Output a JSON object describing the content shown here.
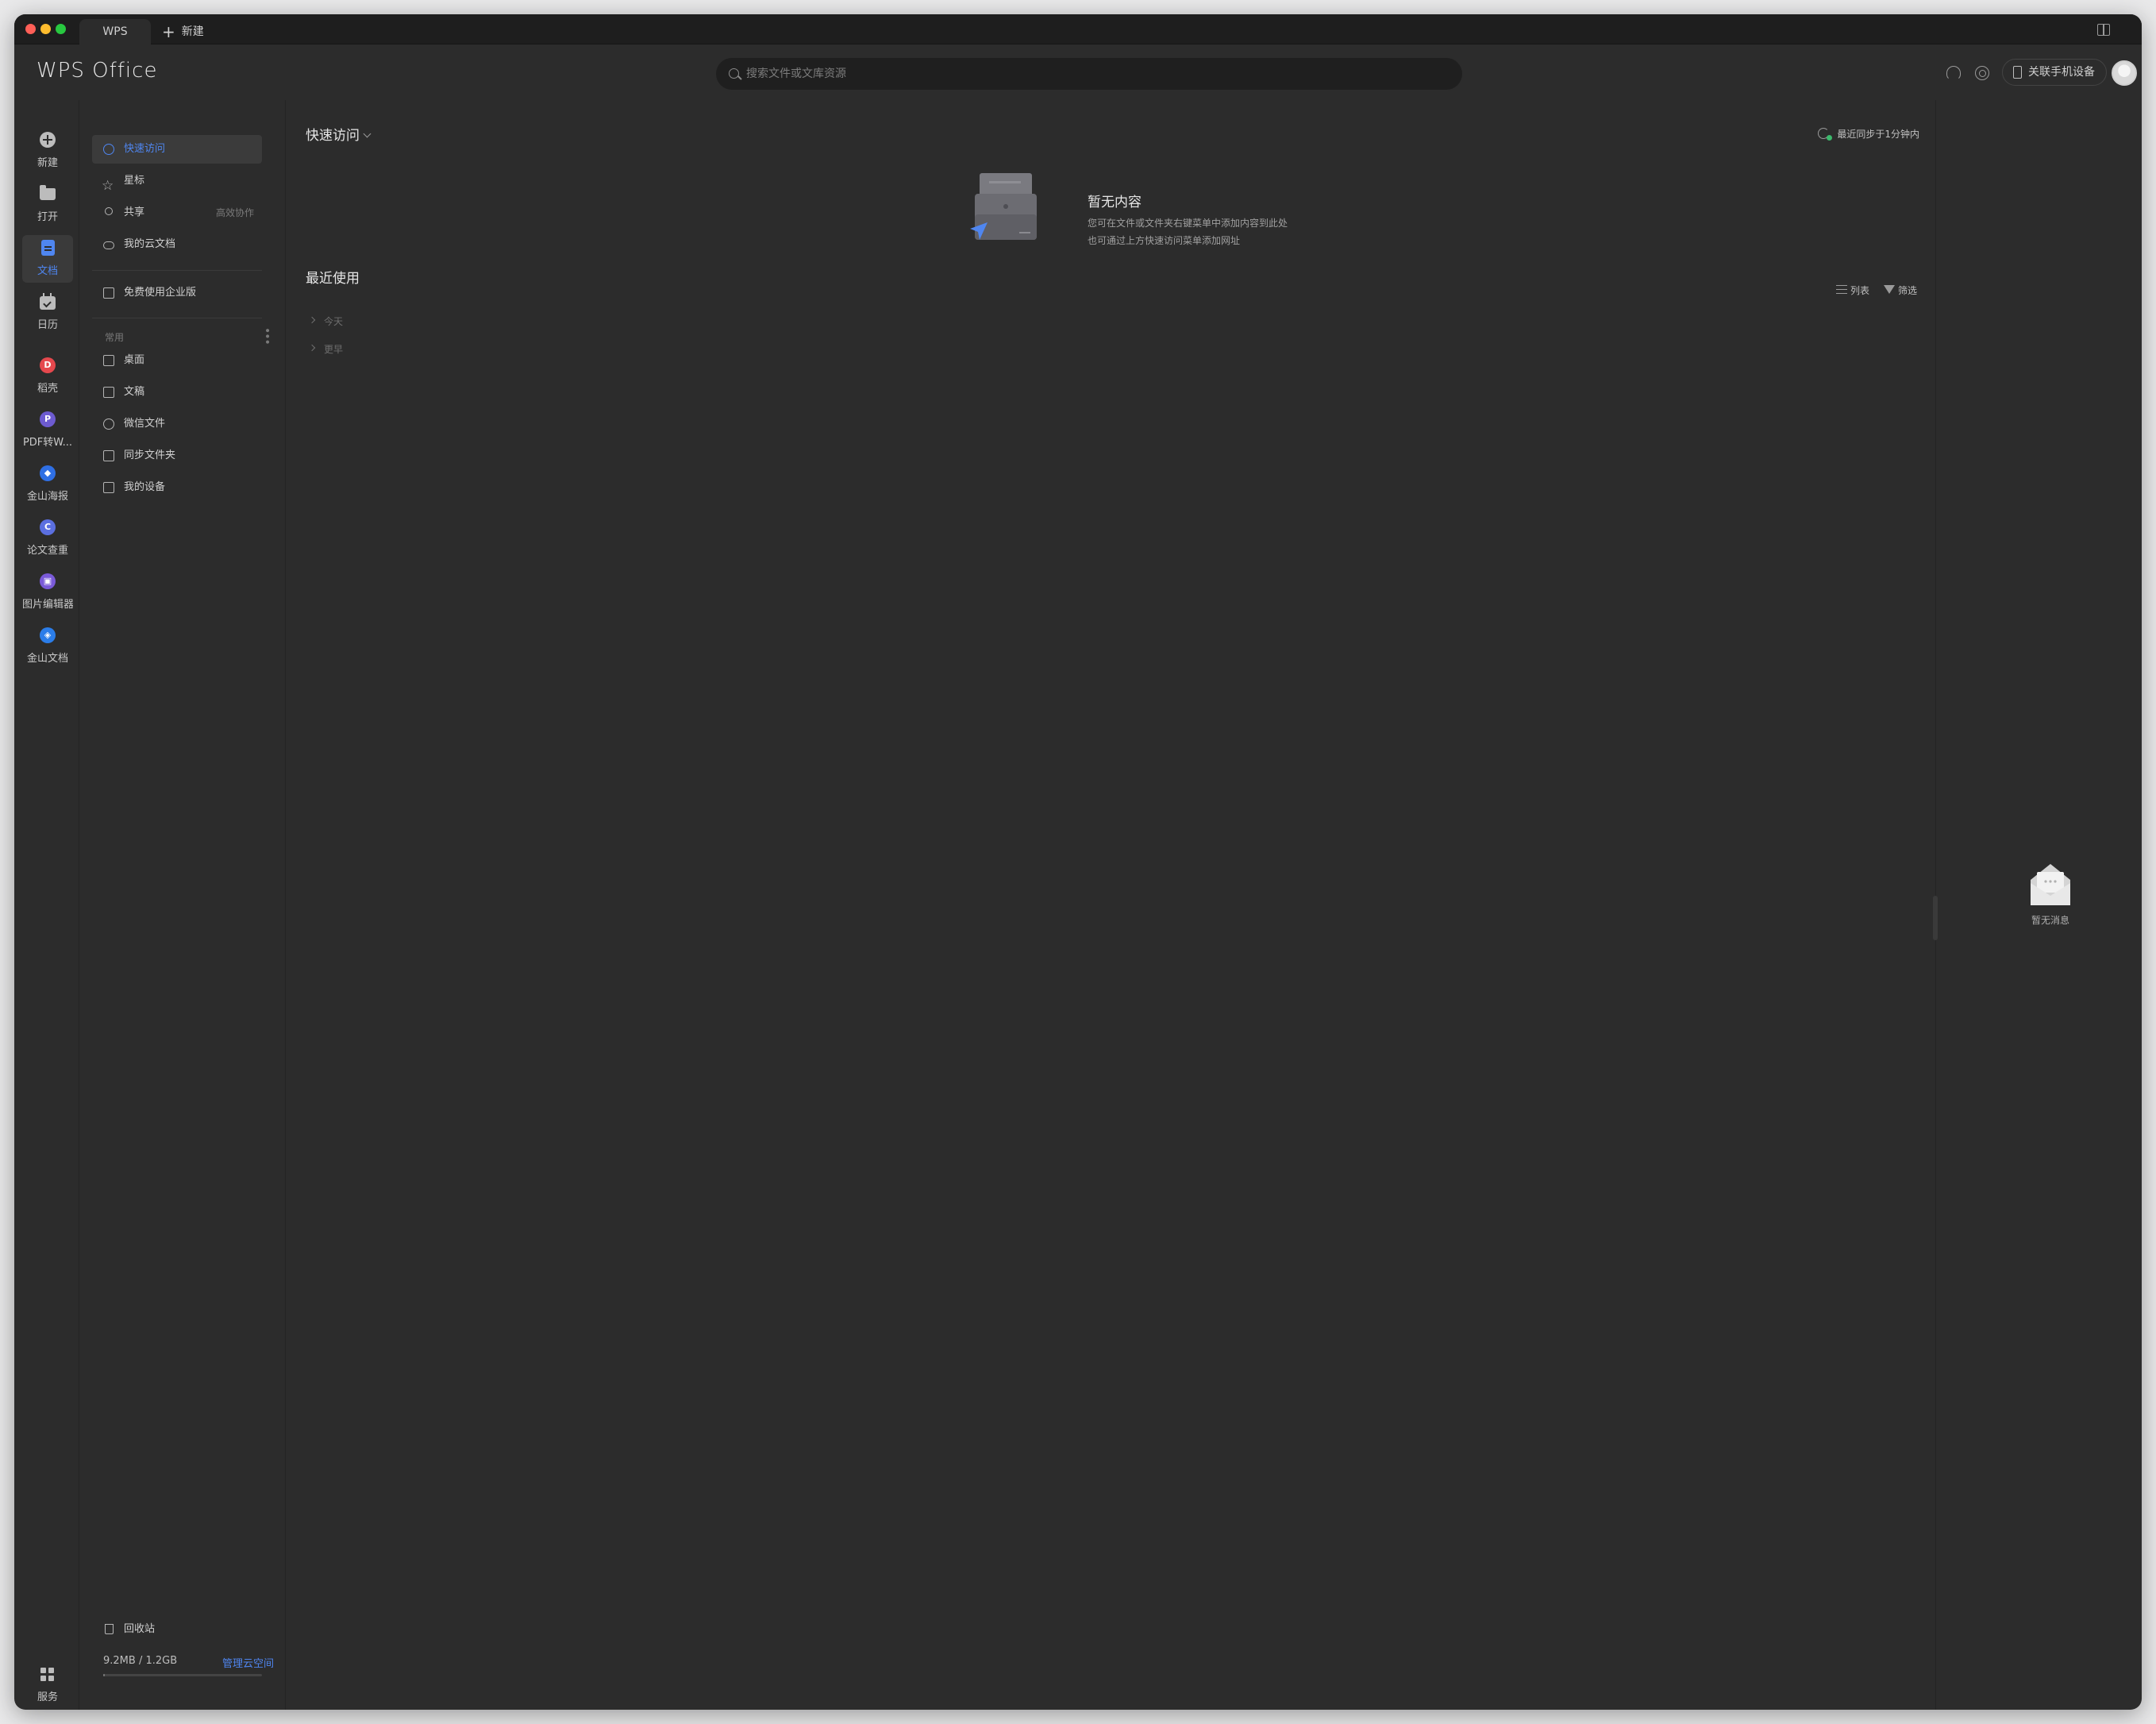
{
  "titlebar": {
    "tabs": [
      {
        "label": "WPS"
      },
      {
        "label": "新建"
      }
    ]
  },
  "header": {
    "logo": "WPS Office",
    "search_placeholder": "搜索文件或文库资源",
    "phone_button": "关联手机设备"
  },
  "rail": {
    "items": [
      {
        "label": "新建",
        "icon": "new-icon"
      },
      {
        "label": "打开",
        "icon": "folder-icon"
      },
      {
        "label": "文档",
        "icon": "document-icon",
        "active": true
      },
      {
        "label": "日历",
        "icon": "calendar-icon"
      },
      {
        "label": "稻壳",
        "icon": "daoke-icon",
        "color": "#e5484d"
      },
      {
        "label": "PDF转W...",
        "icon": "pdf-convert-icon",
        "color": "#6d5bd0"
      },
      {
        "label": "金山海报",
        "icon": "poster-icon",
        "color": "#2f6fe4"
      },
      {
        "label": "论文查重",
        "icon": "paper-check-icon",
        "color": "#5b6fe0"
      },
      {
        "label": "图片编辑器",
        "icon": "image-editor-icon",
        "color": "#7a5ad8"
      },
      {
        "label": "金山文档",
        "icon": "kdocs-icon",
        "color": "#2b7de9"
      }
    ],
    "services_label": "服务"
  },
  "nav": {
    "items": [
      {
        "label": "快速访问",
        "active": true
      },
      {
        "label": "星标"
      },
      {
        "label": "共享",
        "hint": "高效协作"
      },
      {
        "label": "我的云文档"
      },
      {
        "label": "免费使用企业版"
      }
    ],
    "common_section": "常用",
    "common_items": [
      {
        "label": "桌面"
      },
      {
        "label": "文稿"
      },
      {
        "label": "微信文件"
      },
      {
        "label": "同步文件夹"
      },
      {
        "label": "我的设备"
      }
    ],
    "trash": "回收站",
    "storage": "9.2MB / 1.2GB",
    "storage_fraction": 0.0075,
    "manage": "管理云空间"
  },
  "main": {
    "quick_access_title": "快速访问",
    "sync_status": "最近同步于1分钟内",
    "empty_title": "暂无内容",
    "empty_line1": "您可在文件或文件夹右键菜单中添加内容到此处",
    "empty_line2": "也可通过上方快速访问菜单添加网址",
    "recent_title": "最近使用",
    "list_label": "列表",
    "filter_label": "筛选",
    "groups": [
      {
        "label": "今天"
      },
      {
        "label": "更早"
      }
    ]
  },
  "right_panel": {
    "no_messages": "暂无消息"
  },
  "colors": {
    "accent": "#4f86f0",
    "background": "#2c2c2c",
    "sync_ok": "#3cb96c"
  }
}
